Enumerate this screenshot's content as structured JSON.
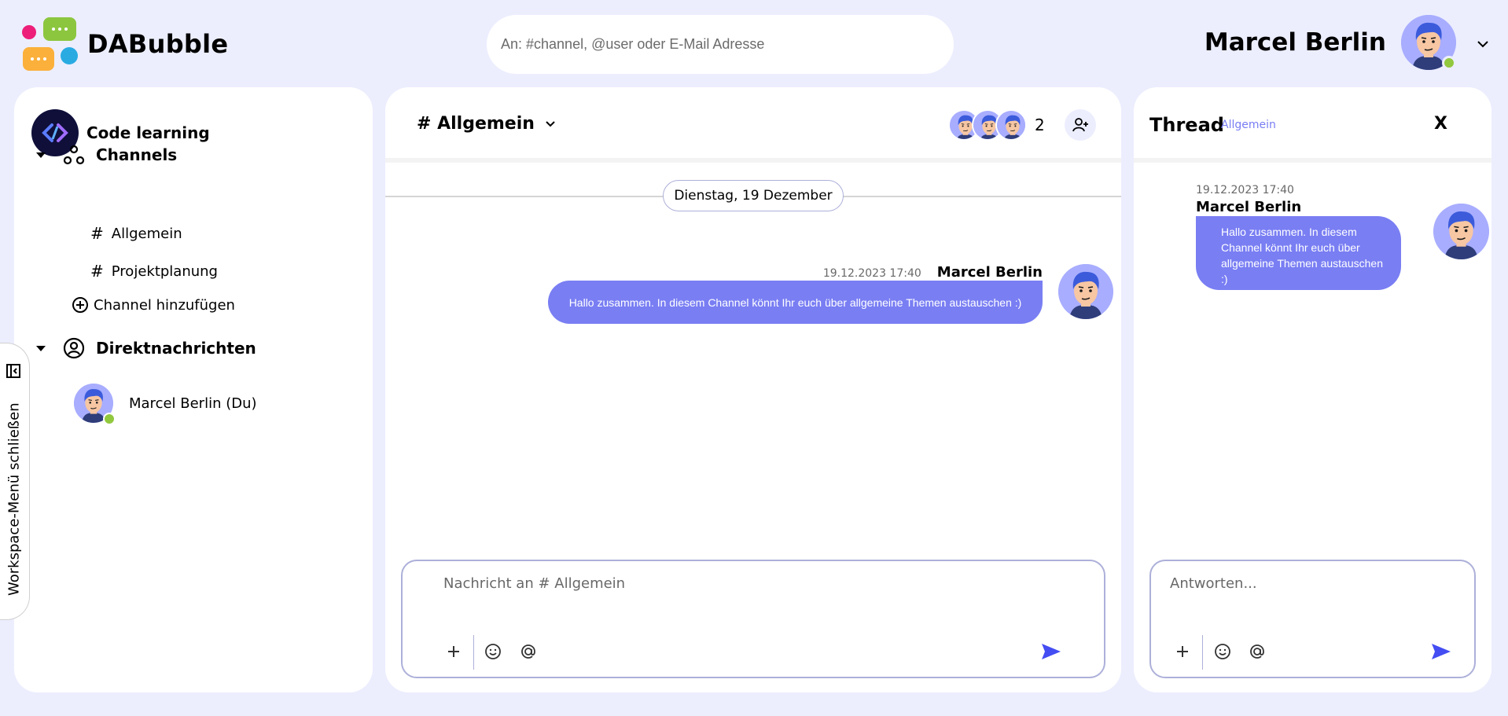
{
  "app": {
    "name": "DABubble"
  },
  "search": {
    "placeholder": "An: #channel, @user oder E-Mail Adresse"
  },
  "user": {
    "name": "Marcel Berlin",
    "status": "online"
  },
  "sidebar": {
    "workspace": "Code learning",
    "channels_label": "Channels",
    "channels": [
      {
        "label": "Allgemein"
      },
      {
        "label": "Projektplanung"
      }
    ],
    "add_channel": "Channel hinzufügen",
    "dm_label": "Direktnachrichten",
    "dms": [
      {
        "label": "Marcel Berlin (Du)"
      }
    ]
  },
  "workspace_toggle": {
    "label": "Workspace-Menü schließen"
  },
  "channel": {
    "title": "# Allgemein",
    "member_count": "2",
    "date_divider": "Dienstag, 19 Dezember",
    "messages": [
      {
        "time": "19.12.2023 17:40",
        "author": "Marcel Berlin",
        "text": "Hallo zusammen. In diesem Channel könnt Ihr euch über allgemeine Themen austauschen :)"
      }
    ],
    "composer_placeholder": "Nachricht an # Allgemein"
  },
  "thread": {
    "title": "Thread",
    "channel": "Allgemein",
    "close": "X",
    "message": {
      "time": "19.12.2023 17:40",
      "author": "Marcel Berlin",
      "text": "Hallo zusammen. In diesem Channel könnt Ihr euch über allgemeine Themen austauschen :)"
    },
    "composer_placeholder": "Antworten..."
  },
  "colors": {
    "background": "#eceefe",
    "accent": "#797ef3",
    "online": "#92c83e",
    "border": "#adb0d9"
  },
  "icons": {
    "logo": "chat-bubbles-logo",
    "workspace": "code-brackets-icon",
    "channels": "channels-nodes-icon",
    "dm": "user-circle-icon",
    "add": "plus-circle-icon",
    "chevron": "chevron-down-icon",
    "add_member": "person-add-icon",
    "attach": "plus-icon",
    "emoji": "smiley-icon",
    "mention": "at-icon",
    "send": "send-icon"
  }
}
